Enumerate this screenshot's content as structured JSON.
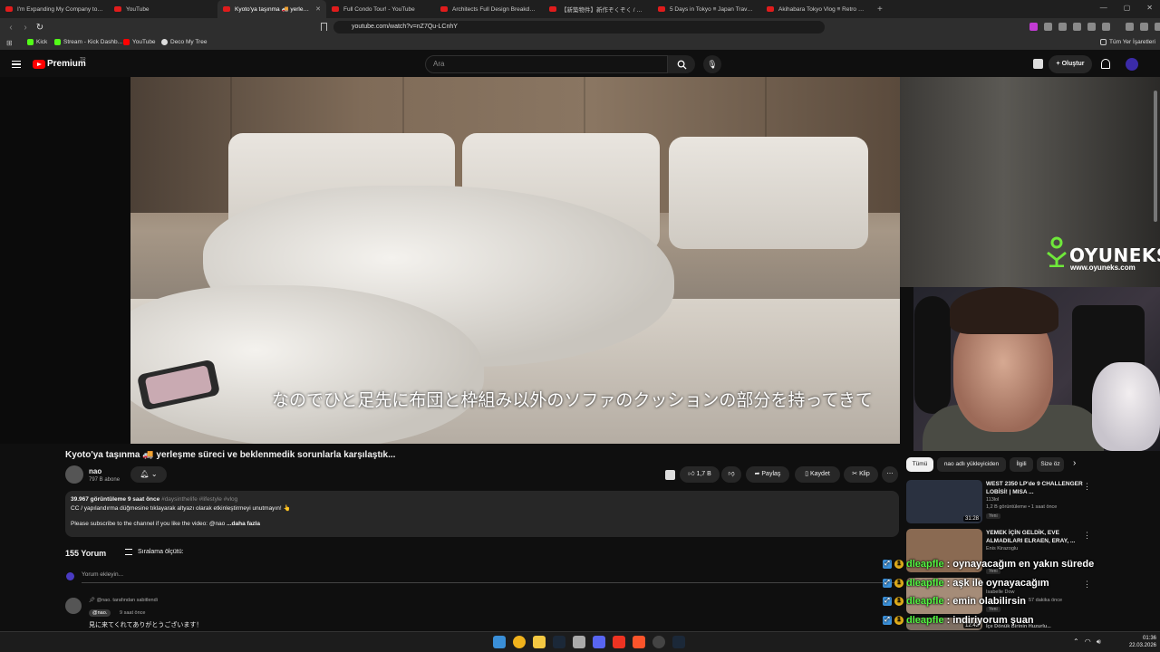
{
  "browser": {
    "tabs": [
      {
        "title": "I'm Expanding My Company to New"
      },
      {
        "title": "YouTube"
      },
      {
        "title": "Kyoto'ya taşınma 🚚 yerleşme s"
      },
      {
        "title": "Full Condo Tour! - YouTube"
      },
      {
        "title": "Architects Full Design Breakdown of"
      },
      {
        "title": "【新築物件】新作ぞくぞく / 家具が勇き"
      },
      {
        "title": "5 Days in Tokyo ≡ Japan Travel Vlog"
      },
      {
        "title": "Akihabara Tokyo Vlog ≡ Retro Game"
      }
    ],
    "new_tab": "+",
    "url": "youtube.com/watch?v=nZ7Qu-LCnhY",
    "bookmarks": [
      {
        "label": "Kick",
        "color": "#53fc18"
      },
      {
        "label": "Stream - Kick Dashb...",
        "color": "#53fc18"
      },
      {
        "label": "YouTube",
        "color": "#ff0000"
      },
      {
        "label": "Deco My Tree",
        "color": "#dddddd"
      }
    ],
    "all_bookmarks": "Tüm Yer İşaretleri"
  },
  "header": {
    "logo_text": "Premium",
    "country": "TR",
    "search_placeholder": "Ara",
    "create_label": "+ Oluştur"
  },
  "video": {
    "subtitle": "なのでひと足先に布団と枠組み以外のソファのクッションの部分を持ってきて",
    "overlay_brand": "OYUNEKS",
    "overlay_url": "www.oyuneks.com"
  },
  "meta": {
    "title": "Kyoto'ya taşınma 🚚 yerleşme süreci ve beklenmedik sorunlarla karşılaştık...",
    "channel": "nao",
    "subscribers": "797 B abone",
    "likes": "1,7 B",
    "share": "Paylaş",
    "save": "Kaydet",
    "clip": "Klip",
    "more": "⋯"
  },
  "description": {
    "stats": "39.967 görüntüleme  9 saat önce",
    "tags": "#daysinthelife #lifestyle #vlog",
    "line1": "CC / yapılandırma düğmesine tıklayarak altyazı olarak etkinleştirmeyi unutmayın! 👆",
    "line2": "Please subscribe to the channel if you like the video: @nao",
    "more": "...daha fazla"
  },
  "comments": {
    "count": "155 Yorum",
    "sort": "Sıralama ölçütü:",
    "add_placeholder": "Yorum ekleyin...",
    "pinned": "@nao. tarafından sabitlendi",
    "author": "@nao.",
    "time": "9 saat önce",
    "text": "見に来てくれてありがとうございます！"
  },
  "sidebar": {
    "chips": [
      "Tümü",
      "nao adlı yükleyiciden",
      "İlgili",
      "Size öz"
    ],
    "recs": [
      {
        "title": "WEST 2350 LP'de 9 CHALLENGER LOBİSİ! | MISA ...",
        "channel": "113lol",
        "meta": "1,2 B görüntüleme • 1 saat önce",
        "badge": "Yeni",
        "duration": "31:28",
        "thumb": "#2a3140"
      },
      {
        "title": "YEMEK İÇİN GELDİK, EVE ALMADILARI ELRAEN, ERAY, ...",
        "channel": "Enis Kirazoglu",
        "meta": "",
        "badge": "Yeni",
        "duration": "",
        "thumb": "#8a6a52"
      },
      {
        "title": "",
        "channel": "Isabelle Dow",
        "meta": "57 dakika önce",
        "badge": "Yeni",
        "duration": "",
        "thumb": "#a58c78"
      },
      {
        "title": "",
        "channel": "İçe Dönük Birinin Huzurlu...",
        "meta": "",
        "badge": "",
        "duration": "12:42",
        "thumb": "#7e6f62"
      }
    ]
  },
  "chat": [
    {
      "user": "dleapfle",
      "msg": ": oynayacağım en yakın sürede"
    },
    {
      "user": "dleapfle",
      "msg": ": aşk ile oynayacağım"
    },
    {
      "user": "dleapfle",
      "msg": ": emin olabilirsin"
    },
    {
      "user": "dleapfle",
      "msg": ": indiriyorum şuan"
    }
  ],
  "taskbar": {
    "time": "01:36",
    "date": "22.03.2026"
  }
}
